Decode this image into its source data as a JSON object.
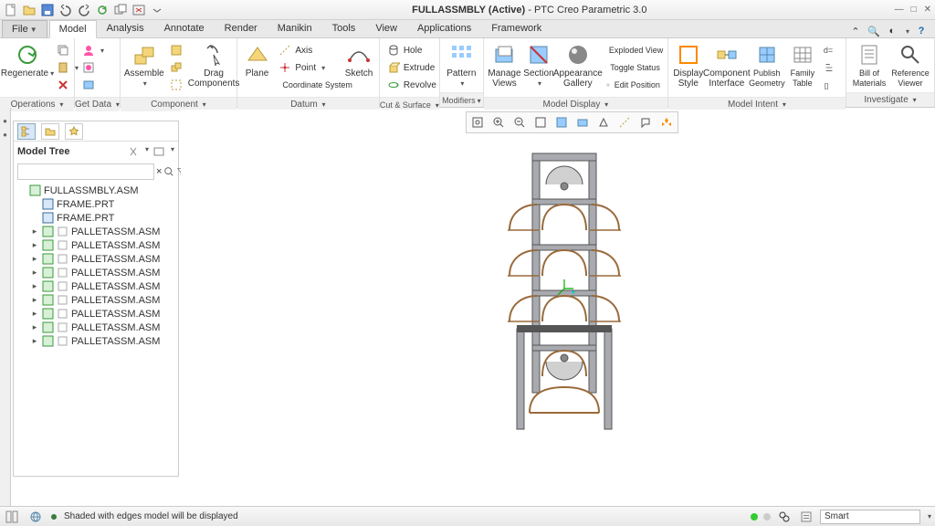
{
  "app": {
    "title_prefix": "FULLASSMBLY (Active)",
    "title_suffix": " - PTC Creo Parametric 3.0"
  },
  "tabs": {
    "file": "File",
    "items": [
      "Model",
      "Analysis",
      "Annotate",
      "Render",
      "Manikin",
      "Tools",
      "View",
      "Applications",
      "Framework"
    ],
    "active_index": 0
  },
  "ribbon": {
    "groups": [
      {
        "label": "Operations",
        "big": [
          {
            "key": "regenerate",
            "label": "Regenerate"
          }
        ],
        "small": [
          {
            "key": "copy",
            "label": ""
          },
          {
            "key": "paste",
            "label": ""
          },
          {
            "key": "close",
            "label": ""
          }
        ]
      },
      {
        "label": "Get Data",
        "big": [],
        "small": [
          {
            "key": "user",
            "label": ""
          },
          {
            "key": "user2",
            "label": ""
          },
          {
            "key": "cloud",
            "label": ""
          }
        ]
      },
      {
        "label": "Component",
        "big": [
          {
            "key": "assemble",
            "label": "Assemble"
          },
          {
            "key": "drag",
            "label": "Drag\nComponents"
          }
        ],
        "small": [
          {
            "key": "c1",
            "label": ""
          },
          {
            "key": "c2",
            "label": ""
          },
          {
            "key": "c3",
            "label": ""
          }
        ]
      },
      {
        "label": "Datum",
        "big": [
          {
            "key": "plane",
            "label": "Plane"
          },
          {
            "key": "sketch",
            "label": "Sketch"
          }
        ],
        "small": [
          {
            "key": "axis",
            "label": "Axis"
          },
          {
            "key": "point",
            "label": "Point"
          },
          {
            "key": "csys",
            "label": "Coordinate System"
          }
        ]
      },
      {
        "label": "Cut & Surface",
        "big": [],
        "small": [
          {
            "key": "hole",
            "label": "Hole"
          },
          {
            "key": "extrude",
            "label": "Extrude"
          },
          {
            "key": "revolve",
            "label": "Revolve"
          }
        ]
      },
      {
        "label": "Modifiers",
        "big": [
          {
            "key": "pattern",
            "label": "Pattern"
          }
        ],
        "small": []
      },
      {
        "label": "Model Display",
        "big": [
          {
            "key": "mviews",
            "label": "Manage\nViews"
          },
          {
            "key": "section",
            "label": "Section"
          },
          {
            "key": "agallery",
            "label": "Appearance\nGallery"
          }
        ],
        "small": [
          {
            "key": "exploded",
            "label": "Exploded View"
          },
          {
            "key": "toggle",
            "label": "Toggle Status"
          },
          {
            "key": "editpos",
            "label": "Edit Position"
          }
        ]
      },
      {
        "label": "Model Intent",
        "big": [
          {
            "key": "dstyle",
            "label": "Display\nStyle"
          },
          {
            "key": "cint",
            "label": "Component\nInterface"
          },
          {
            "key": "pubgeo",
            "label": "Publish\nGeometry"
          },
          {
            "key": "ftable",
            "label": "Family\nTable"
          }
        ],
        "small": [
          {
            "key": "deq",
            "label": "d="
          },
          {
            "key": "brk",
            "label": ""
          },
          {
            "key": "fx",
            "label": ""
          }
        ]
      },
      {
        "label": "Investigate",
        "big": [
          {
            "key": "bom",
            "label": "Bill of\nMaterials"
          },
          {
            "key": "rview",
            "label": "Reference\nViewer"
          }
        ],
        "small": []
      }
    ]
  },
  "tree": {
    "title": "Model Tree",
    "search_placeholder": "",
    "root": "FULLASSMBLY.ASM",
    "items": [
      {
        "type": "part",
        "label": "FRAME.PRT"
      },
      {
        "type": "part",
        "label": "FRAME.PRT"
      },
      {
        "type": "asm",
        "label": "PALLETASSM.ASM"
      },
      {
        "type": "asm",
        "label": "PALLETASSM.ASM"
      },
      {
        "type": "asm",
        "label": "PALLETASSM.ASM"
      },
      {
        "type": "asm",
        "label": "PALLETASSM.ASM"
      },
      {
        "type": "asm",
        "label": "PALLETASSM.ASM"
      },
      {
        "type": "asm",
        "label": "PALLETASSM.ASM"
      },
      {
        "type": "asm",
        "label": "PALLETASSM.ASM"
      },
      {
        "type": "asm",
        "label": "PALLETASSM.ASM"
      },
      {
        "type": "asm",
        "label": "PALLETASSM.ASM"
      }
    ]
  },
  "status": {
    "msg": "Shaded with edges model will be displayed",
    "filter": "Smart"
  }
}
